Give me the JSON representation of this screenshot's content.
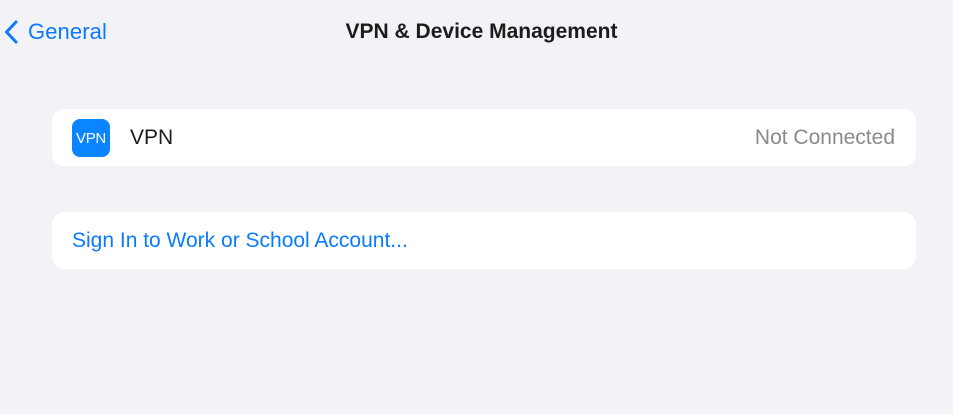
{
  "nav": {
    "back_label": "General",
    "title": "VPN & Device Management"
  },
  "vpn_section": {
    "icon_text": "VPN",
    "label": "VPN",
    "status": "Not Connected"
  },
  "account_section": {
    "sign_in_label": "Sign In to Work or School Account..."
  },
  "colors": {
    "background": "#f2f2f7",
    "accent": "#0a7aff",
    "vpn_icon_bg": "#0a84ff",
    "secondary_text": "#8a8a8e"
  },
  "icons": {
    "back": "chevron-left-icon",
    "vpn": "vpn-icon"
  }
}
